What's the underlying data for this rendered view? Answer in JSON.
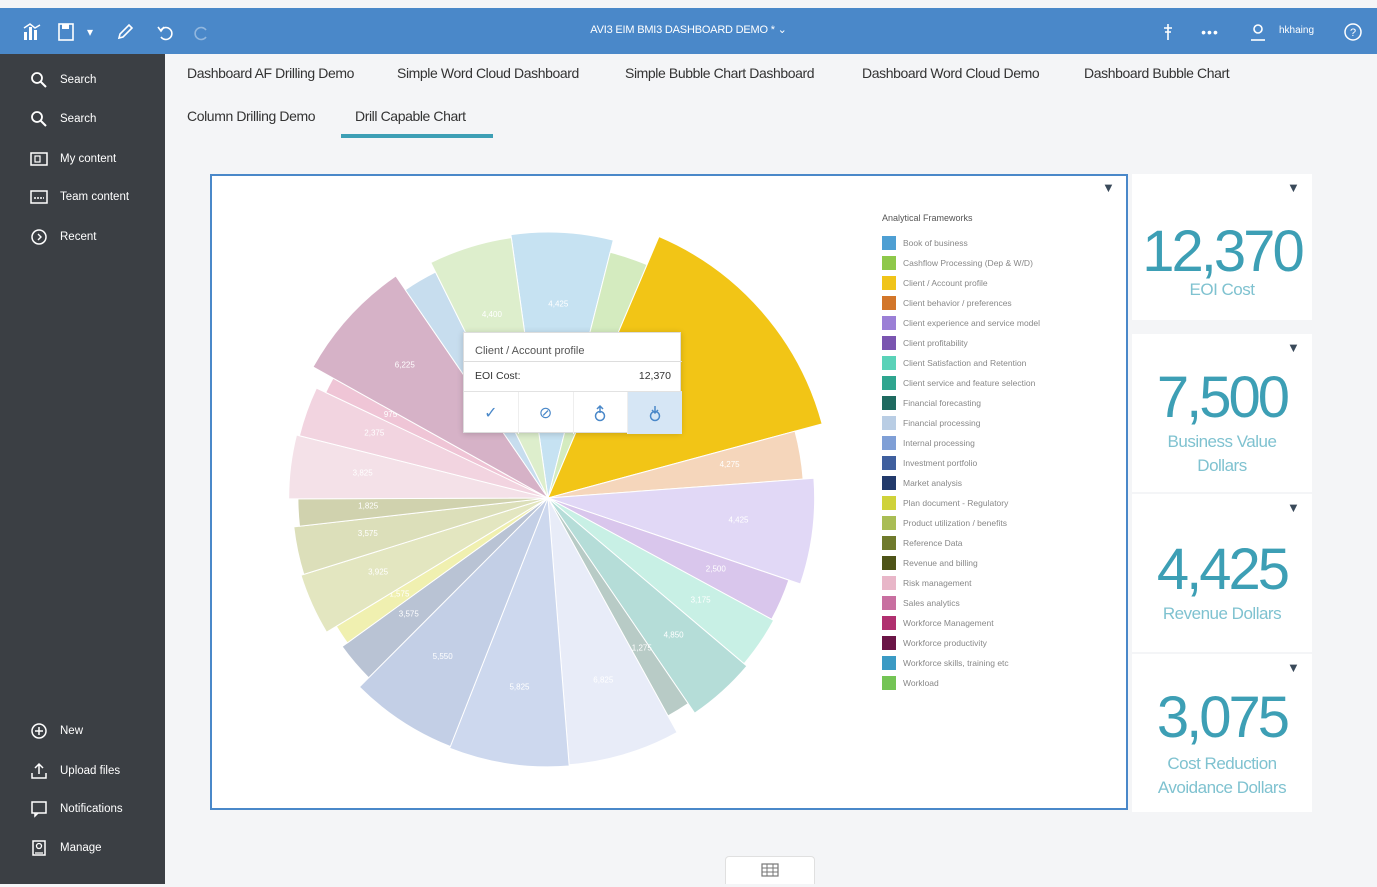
{
  "topbar": {
    "title": "AVI3 EIM BMI3 DASHBOARD DEMO *",
    "user": "hkhaing",
    "icons": [
      "bar-chart-icon",
      "save-icon",
      "pencil-icon",
      "undo-icon",
      "redo-icon",
      "pin-icon",
      "more-icon",
      "user-icon",
      "help-icon"
    ]
  },
  "sidebar": {
    "top_items": [
      {
        "label": "Search",
        "icon": "search-icon"
      },
      {
        "label": "Search",
        "icon": "search-icon"
      },
      {
        "label": "My content",
        "icon": "folder-icon"
      },
      {
        "label": "Team content",
        "icon": "team-folder-icon"
      },
      {
        "label": "Recent",
        "icon": "clock-icon"
      }
    ],
    "bottom_items": [
      {
        "label": "New",
        "icon": "plus-icon"
      },
      {
        "label": "Upload files",
        "icon": "upload-icon"
      },
      {
        "label": "Notifications",
        "icon": "chat-icon"
      },
      {
        "label": "Manage",
        "icon": "manage-icon"
      }
    ]
  },
  "tabs": [
    "Dashboard AF Drilling Demo",
    "Simple Word Cloud Dashboard",
    "Simple Bubble Chart Dashboard",
    "Dashboard Word Cloud Demo",
    "Dashboard Bubble Chart",
    "Column Drilling Demo",
    "Drill Capable Chart"
  ],
  "active_tab": "Drill Capable Chart",
  "kpis": [
    {
      "value": "12,370",
      "label_lines": [
        "EOI Cost"
      ]
    },
    {
      "value": "7,500",
      "label_lines": [
        "Business Value",
        "Dollars"
      ]
    },
    {
      "value": "4,425",
      "label_lines": [
        "Revenue Dollars"
      ]
    },
    {
      "value": "3,075",
      "label_lines": [
        "Cost Reduction",
        "Avoidance Dollars"
      ]
    }
  ],
  "tooltip": {
    "title": "Client / Account profile",
    "key": "EOI Cost:",
    "value": "12,370",
    "actions": [
      "check-icon",
      "exclude-icon",
      "drill-up-icon",
      "drill-down-icon"
    ]
  },
  "chart_data": {
    "type": "pie",
    "legend_title": "Analytical Frameworks",
    "legend_placement": "right",
    "categories": [
      "Book of business",
      "Cashflow Processing (Dep & W/D)",
      "Client / Account profile",
      "Client behavior / preferences",
      "Client experience and service model",
      "Client profitability",
      "Client Satisfaction and Retention",
      "Client service and feature selection",
      "Financial forecasting",
      "Financial processing",
      "Internal processing",
      "Investment portfolio",
      "Market analysis",
      "Plan document - Regulatory",
      "Product utilization / benefits",
      "Reference Data",
      "Revenue and billing",
      "Risk management",
      "Sales analytics",
      "Workforce Management",
      "Workforce productivity",
      "Workforce skills, training etc",
      "Workload"
    ],
    "legend_colors": [
      "#4e9fd3",
      "#8ec84a",
      "#f0c419",
      "#d2762a",
      "#9b7fd6",
      "#7a55b0",
      "#5ad2b8",
      "#2fa58f",
      "#1f6a60",
      "#b9cde4",
      "#7f9fd6",
      "#3f5f9e",
      "#223a6b",
      "#cfd23a",
      "#a9bd55",
      "#6f7a2c",
      "#4e5418",
      "#e8b6c8",
      "#c86fa0",
      "#b0306f",
      "#6a1546",
      "#3b9ac4",
      "#74c455"
    ],
    "pie_slices": [
      {
        "value": 5300,
        "color": "#c6e2f2",
        "label": "4,425"
      },
      {
        "value": 2100,
        "color": "#d4ebbf",
        "label": ""
      },
      {
        "value": 12370,
        "color": "#f2c516",
        "label": ""
      },
      {
        "value": 2600,
        "color": "#f5d6bb",
        "label": "4,275"
      },
      {
        "value": 5500,
        "color": "#e1d8f6",
        "label": "4,425"
      },
      {
        "value": 2300,
        "color": "#d9c6ec",
        "label": "2,500"
      },
      {
        "value": 2800,
        "color": "#c8f0e5",
        "label": "3,175"
      },
      {
        "value": 3700,
        "color": "#b5ddd8",
        "label": "4,850"
      },
      {
        "value": 1300,
        "color": "#b8cbc6",
        "label": "1,275"
      },
      {
        "value": 5800,
        "color": "#e8ecf8",
        "label": "6,825"
      },
      {
        "value": 6200,
        "color": "#cdd8ee",
        "label": "5,825"
      },
      {
        "value": 5600,
        "color": "#c3cfe6",
        "label": "5,550"
      },
      {
        "value": 2200,
        "color": "#b9c3d4",
        "label": "3,575"
      },
      {
        "value": 1100,
        "color": "#f0f0b0",
        "label": "1,575"
      },
      {
        "value": 3300,
        "color": "#e3e6c0",
        "label": "3,925"
      },
      {
        "value": 2600,
        "color": "#dcdfba",
        "label": "3,575"
      },
      {
        "value": 1500,
        "color": "#d0d2ae",
        "label": "1,825"
      },
      {
        "value": 3400,
        "color": "#f4e1e8",
        "label": "3,825"
      },
      {
        "value": 2700,
        "color": "#f2d4e0",
        "label": "2,375"
      },
      {
        "value": 900,
        "color": "#efc5d6",
        "label": "975"
      },
      {
        "value": 6300,
        "color": "#d6b2c7",
        "label": "6,225"
      },
      {
        "value": 1900,
        "color": "#c7ddee",
        "label": ""
      },
      {
        "value": 4400,
        "color": "#ddeecc",
        "label": "4,400"
      }
    ]
  },
  "bottom_tab": {
    "icon": "table-icon"
  }
}
